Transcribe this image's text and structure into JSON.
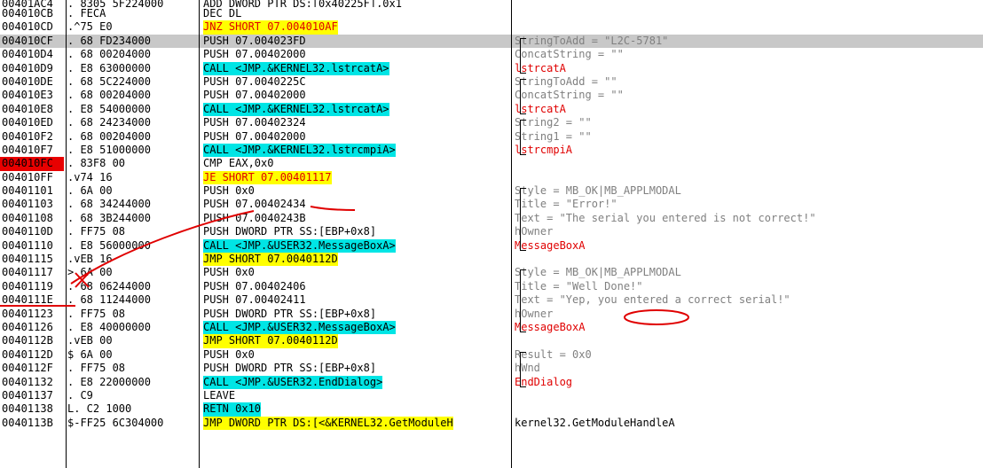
{
  "rows": [
    {
      "address": "00401AC4",
      "hex": ". 8305 5F224000",
      "dis": "ADD DWORD PTR DS:[0x40225F],0x1",
      "dis_style": "",
      "comment": "",
      "comment_style": ""
    },
    {
      "address": "004010CB",
      "hex": ". FECA",
      "dis": "DEC DL",
      "dis_style": "",
      "comment": "",
      "comment_style": ""
    },
    {
      "address": "004010CD",
      "hex": ".^75 E0",
      "dis": "JNZ SHORT 07.004010AF",
      "dis_style": "yellow-red",
      "comment": "",
      "comment_style": ""
    },
    {
      "address": "004010CF",
      "hex": ". 68 FD234000",
      "dis": "PUSH 07.004023FD",
      "dis_style": "",
      "comment": "StringToAdd = \"L2C-5781\"",
      "comment_style": "grey-val"
    },
    {
      "address": "004010D4",
      "hex": ". 68 00204000",
      "dis": "PUSH 07.00402000",
      "dis_style": "",
      "comment": "ConcatString = \"\"",
      "comment_style": "grey-val"
    },
    {
      "address": "004010D9",
      "hex": ". E8 63000000",
      "dis": "CALL <JMP.&KERNEL32.lstrcatA>",
      "dis_style": "cyan",
      "comment": "lstrcatA",
      "comment_style": "red"
    },
    {
      "address": "004010DE",
      "hex": ". 68 5C224000",
      "dis": "PUSH 07.0040225C",
      "dis_style": "",
      "comment": "StringToAdd = \"\"",
      "comment_style": "grey-val"
    },
    {
      "address": "004010E3",
      "hex": ". 68 00204000",
      "dis": "PUSH 07.00402000",
      "dis_style": "",
      "comment": "ConcatString = \"\"",
      "comment_style": "grey-val"
    },
    {
      "address": "004010E8",
      "hex": ". E8 54000000",
      "dis": "CALL <JMP.&KERNEL32.lstrcatA>",
      "dis_style": "cyan",
      "comment": "lstrcatA",
      "comment_style": "red"
    },
    {
      "address": "004010ED",
      "hex": ". 68 24234000",
      "dis": "PUSH 07.00402324",
      "dis_style": "",
      "comment": "String2 = \"\"",
      "comment_style": "grey-val"
    },
    {
      "address": "004010F2",
      "hex": ". 68 00204000",
      "dis": "PUSH 07.00402000",
      "dis_style": "",
      "comment": "String1 = \"\"",
      "comment_style": "grey-val"
    },
    {
      "address": "004010F7",
      "hex": ". E8 51000000",
      "dis": "CALL <JMP.&KERNEL32.lstrcmpiA>",
      "dis_style": "cyan",
      "comment": "lstrcmpiA",
      "comment_style": "red"
    },
    {
      "address": "004010FC",
      "hex": ". 83F8 00",
      "dis": "CMP EAX,0x0",
      "dis_style": "",
      "comment": "",
      "comment_style": ""
    },
    {
      "address": "004010FF",
      "hex": ".v74 16",
      "dis": "JE SHORT 07.00401117",
      "dis_style": "yellow-red",
      "comment": "",
      "comment_style": ""
    },
    {
      "address": "00401101",
      "hex": ". 6A 00",
      "dis": "PUSH 0x0",
      "dis_style": "",
      "comment": "Style = MB_OK|MB_APPLMODAL",
      "comment_style": "grey-val"
    },
    {
      "address": "00401103",
      "hex": ". 68 34244000",
      "dis": "PUSH 07.00402434",
      "dis_style": "",
      "comment": "Title = \"Error!\"",
      "comment_style": "grey-val"
    },
    {
      "address": "00401108",
      "hex": ". 68 3B244000",
      "dis": "PUSH 07.0040243B",
      "dis_style": "",
      "comment": "Text = \"The serial you entered is not correct!\"",
      "comment_style": "grey-val"
    },
    {
      "address": "0040110D",
      "hex": ". FF75 08",
      "dis": "PUSH DWORD PTR SS:[EBP+0x8]",
      "dis_style": "",
      "comment": "hOwner",
      "comment_style": "grey"
    },
    {
      "address": "00401110",
      "hex": ". E8 56000000",
      "dis": "CALL <JMP.&USER32.MessageBoxA>",
      "dis_style": "cyan",
      "comment": "MessageBoxA",
      "comment_style": "red"
    },
    {
      "address": "00401115",
      "hex": ".vEB 16",
      "dis": "JMP SHORT 07.0040112D",
      "dis_style": "yellow",
      "comment": "",
      "comment_style": ""
    },
    {
      "address": "00401117",
      "hex": "> 6A 00",
      "dis": "PUSH 0x0",
      "dis_style": "",
      "comment": "Style = MB_OK|MB_APPLMODAL",
      "comment_style": "grey-val"
    },
    {
      "address": "00401119",
      "hex": ". 68 06244000",
      "dis": "PUSH 07.00402406",
      "dis_style": "",
      "comment": "Title = \"Well Done!\"",
      "comment_style": "grey-val"
    },
    {
      "address": "0040111E",
      "hex": ". 68 11244000",
      "dis": "PUSH 07.00402411",
      "dis_style": "",
      "comment": "Text = \"Yep, you entered a correct serial!\"",
      "comment_style": "grey-val"
    },
    {
      "address": "00401123",
      "hex": ". FF75 08",
      "dis": "PUSH DWORD PTR SS:[EBP+0x8]",
      "dis_style": "",
      "comment": "hOwner",
      "comment_style": "grey"
    },
    {
      "address": "00401126",
      "hex": ". E8 40000000",
      "dis": "CALL <JMP.&USER32.MessageBoxA>",
      "dis_style": "cyan",
      "comment": "MessageBoxA",
      "comment_style": "red"
    },
    {
      "address": "0040112B",
      "hex": ".vEB 00",
      "dis": "JMP SHORT 07.0040112D",
      "dis_style": "yellow",
      "comment": "",
      "comment_style": ""
    },
    {
      "address": "0040112D",
      "hex": "$ 6A 00",
      "dis": "PUSH 0x0",
      "dis_style": "",
      "comment": "Result = 0x0",
      "comment_style": "grey-val"
    },
    {
      "address": "0040112F",
      "hex": ". FF75 08",
      "dis": "PUSH DWORD PTR SS:[EBP+0x8]",
      "dis_style": "",
      "comment": "hWnd",
      "comment_style": "grey"
    },
    {
      "address": "00401132",
      "hex": ". E8 22000000",
      "dis": "CALL <JMP.&USER32.EndDialog>",
      "dis_style": "cyan",
      "comment": "EndDialog",
      "comment_style": "red"
    },
    {
      "address": "00401137",
      "hex": ". C9",
      "dis": "LEAVE",
      "dis_style": "",
      "comment": "",
      "comment_style": ""
    },
    {
      "address": "00401138",
      "hex": "L. C2 1000",
      "dis": "RETN 0x10",
      "dis_style": "cyan",
      "comment": "",
      "comment_style": ""
    },
    {
      "address": "0040113B",
      "hex": "$-FF25 6C304000",
      "dis": "JMP DWORD PTR DS:[<&KERNEL32.GetModuleH",
      "dis_style": "yellow",
      "comment": "kernel32.GetModuleHandleA",
      "comment_style": ""
    }
  ],
  "selected_index": 3,
  "breakpoint_index": 12,
  "colors": {
    "breakpoint": "#e80000",
    "selected": "#c8c8c8",
    "call": "#00e5e5",
    "jump": "#ffff00",
    "jump_text": "#e00000",
    "annotation": "#e00000"
  }
}
